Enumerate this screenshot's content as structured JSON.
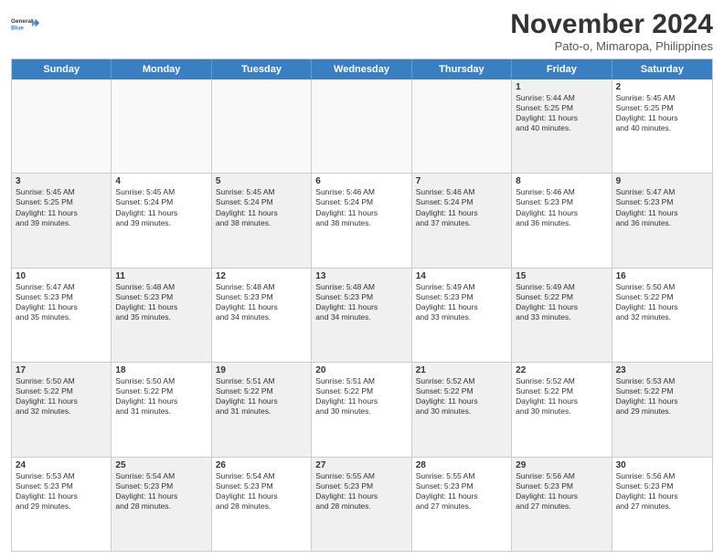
{
  "header": {
    "logo_line1": "General",
    "logo_line2": "Blue",
    "main_title": "November 2024",
    "subtitle": "Pato-o, Mimaropa, Philippines"
  },
  "calendar": {
    "days_of_week": [
      "Sunday",
      "Monday",
      "Tuesday",
      "Wednesday",
      "Thursday",
      "Friday",
      "Saturday"
    ],
    "rows": [
      [
        {
          "day": "",
          "info": "",
          "empty": true
        },
        {
          "day": "",
          "info": "",
          "empty": true
        },
        {
          "day": "",
          "info": "",
          "empty": true
        },
        {
          "day": "",
          "info": "",
          "empty": true
        },
        {
          "day": "",
          "info": "",
          "empty": true
        },
        {
          "day": "1",
          "info": "Sunrise: 5:44 AM\nSunset: 5:25 PM\nDaylight: 11 hours\nand 40 minutes.",
          "empty": false,
          "shaded": true
        },
        {
          "day": "2",
          "info": "Sunrise: 5:45 AM\nSunset: 5:25 PM\nDaylight: 11 hours\nand 40 minutes.",
          "empty": false,
          "shaded": false
        }
      ],
      [
        {
          "day": "3",
          "info": "Sunrise: 5:45 AM\nSunset: 5:25 PM\nDaylight: 11 hours\nand 39 minutes.",
          "empty": false,
          "shaded": true
        },
        {
          "day": "4",
          "info": "Sunrise: 5:45 AM\nSunset: 5:24 PM\nDaylight: 11 hours\nand 39 minutes.",
          "empty": false,
          "shaded": false
        },
        {
          "day": "5",
          "info": "Sunrise: 5:45 AM\nSunset: 5:24 PM\nDaylight: 11 hours\nand 38 minutes.",
          "empty": false,
          "shaded": true
        },
        {
          "day": "6",
          "info": "Sunrise: 5:46 AM\nSunset: 5:24 PM\nDaylight: 11 hours\nand 38 minutes.",
          "empty": false,
          "shaded": false
        },
        {
          "day": "7",
          "info": "Sunrise: 5:46 AM\nSunset: 5:24 PM\nDaylight: 11 hours\nand 37 minutes.",
          "empty": false,
          "shaded": true
        },
        {
          "day": "8",
          "info": "Sunrise: 5:46 AM\nSunset: 5:23 PM\nDaylight: 11 hours\nand 36 minutes.",
          "empty": false,
          "shaded": false
        },
        {
          "day": "9",
          "info": "Sunrise: 5:47 AM\nSunset: 5:23 PM\nDaylight: 11 hours\nand 36 minutes.",
          "empty": false,
          "shaded": true
        }
      ],
      [
        {
          "day": "10",
          "info": "Sunrise: 5:47 AM\nSunset: 5:23 PM\nDaylight: 11 hours\nand 35 minutes.",
          "empty": false,
          "shaded": false
        },
        {
          "day": "11",
          "info": "Sunrise: 5:48 AM\nSunset: 5:23 PM\nDaylight: 11 hours\nand 35 minutes.",
          "empty": false,
          "shaded": true
        },
        {
          "day": "12",
          "info": "Sunrise: 5:48 AM\nSunset: 5:23 PM\nDaylight: 11 hours\nand 34 minutes.",
          "empty": false,
          "shaded": false
        },
        {
          "day": "13",
          "info": "Sunrise: 5:48 AM\nSunset: 5:23 PM\nDaylight: 11 hours\nand 34 minutes.",
          "empty": false,
          "shaded": true
        },
        {
          "day": "14",
          "info": "Sunrise: 5:49 AM\nSunset: 5:23 PM\nDaylight: 11 hours\nand 33 minutes.",
          "empty": false,
          "shaded": false
        },
        {
          "day": "15",
          "info": "Sunrise: 5:49 AM\nSunset: 5:22 PM\nDaylight: 11 hours\nand 33 minutes.",
          "empty": false,
          "shaded": true
        },
        {
          "day": "16",
          "info": "Sunrise: 5:50 AM\nSunset: 5:22 PM\nDaylight: 11 hours\nand 32 minutes.",
          "empty": false,
          "shaded": false
        }
      ],
      [
        {
          "day": "17",
          "info": "Sunrise: 5:50 AM\nSunset: 5:22 PM\nDaylight: 11 hours\nand 32 minutes.",
          "empty": false,
          "shaded": true
        },
        {
          "day": "18",
          "info": "Sunrise: 5:50 AM\nSunset: 5:22 PM\nDaylight: 11 hours\nand 31 minutes.",
          "empty": false,
          "shaded": false
        },
        {
          "day": "19",
          "info": "Sunrise: 5:51 AM\nSunset: 5:22 PM\nDaylight: 11 hours\nand 31 minutes.",
          "empty": false,
          "shaded": true
        },
        {
          "day": "20",
          "info": "Sunrise: 5:51 AM\nSunset: 5:22 PM\nDaylight: 11 hours\nand 30 minutes.",
          "empty": false,
          "shaded": false
        },
        {
          "day": "21",
          "info": "Sunrise: 5:52 AM\nSunset: 5:22 PM\nDaylight: 11 hours\nand 30 minutes.",
          "empty": false,
          "shaded": true
        },
        {
          "day": "22",
          "info": "Sunrise: 5:52 AM\nSunset: 5:22 PM\nDaylight: 11 hours\nand 30 minutes.",
          "empty": false,
          "shaded": false
        },
        {
          "day": "23",
          "info": "Sunrise: 5:53 AM\nSunset: 5:22 PM\nDaylight: 11 hours\nand 29 minutes.",
          "empty": false,
          "shaded": true
        }
      ],
      [
        {
          "day": "24",
          "info": "Sunrise: 5:53 AM\nSunset: 5:23 PM\nDaylight: 11 hours\nand 29 minutes.",
          "empty": false,
          "shaded": false
        },
        {
          "day": "25",
          "info": "Sunrise: 5:54 AM\nSunset: 5:23 PM\nDaylight: 11 hours\nand 28 minutes.",
          "empty": false,
          "shaded": true
        },
        {
          "day": "26",
          "info": "Sunrise: 5:54 AM\nSunset: 5:23 PM\nDaylight: 11 hours\nand 28 minutes.",
          "empty": false,
          "shaded": false
        },
        {
          "day": "27",
          "info": "Sunrise: 5:55 AM\nSunset: 5:23 PM\nDaylight: 11 hours\nand 28 minutes.",
          "empty": false,
          "shaded": true
        },
        {
          "day": "28",
          "info": "Sunrise: 5:55 AM\nSunset: 5:23 PM\nDaylight: 11 hours\nand 27 minutes.",
          "empty": false,
          "shaded": false
        },
        {
          "day": "29",
          "info": "Sunrise: 5:56 AM\nSunset: 5:23 PM\nDaylight: 11 hours\nand 27 minutes.",
          "empty": false,
          "shaded": true
        },
        {
          "day": "30",
          "info": "Sunrise: 5:56 AM\nSunset: 5:23 PM\nDaylight: 11 hours\nand 27 minutes.",
          "empty": false,
          "shaded": false
        }
      ]
    ]
  }
}
